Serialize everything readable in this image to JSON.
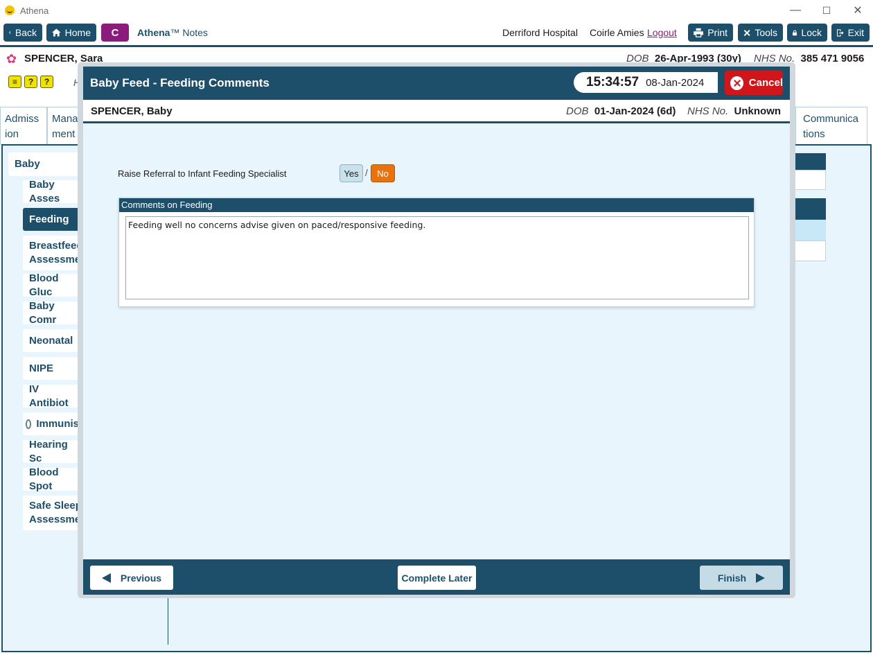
{
  "window": {
    "title": "Athena",
    "minimize": "—",
    "maximize": "☐",
    "close": "✕"
  },
  "toolbar": {
    "back_label": "Back",
    "home_label": "Home",
    "c_label": "C",
    "brand_name": "Athena",
    "brand_tm": "™",
    "brand_suffix": "Notes",
    "hospital": "Derriford Hospital",
    "user": "Coirle Amies",
    "logout_label": "Logout",
    "print_label": "Print",
    "tools_label": "Tools",
    "lock_label": "Lock",
    "exit_label": "Exit"
  },
  "patient": {
    "name": "SPENCER, Sara",
    "dob_label": "DOB",
    "dob": "26-Apr-1993 (30y)",
    "nhs_label": "NHS No.",
    "nhs": "385 471 9056"
  },
  "background": {
    "header_partial": "H",
    "tabs": [
      {
        "label": "Admiss ion"
      },
      {
        "label": "Mana ment"
      },
      {
        "label": "Communica tions"
      }
    ],
    "sidebar": {
      "group": "Baby",
      "items": [
        {
          "label": "Baby Asses"
        },
        {
          "label": "Feeding"
        },
        {
          "label": "Breastfeedi Assessmen"
        },
        {
          "label": "Blood Gluc"
        },
        {
          "label": "Baby Comr"
        },
        {
          "label": "Neonatal"
        },
        {
          "label": "NIPE"
        },
        {
          "label": "IV Antibiot"
        },
        {
          "label": "Immunis"
        },
        {
          "label": "Hearing Sc"
        },
        {
          "label": "Blood Spot"
        },
        {
          "label": "Safe Sleepi Assessmen"
        }
      ]
    }
  },
  "modal": {
    "title": "Baby Feed - Feeding Comments",
    "time": "15:34:57",
    "date": "08-Jan-2024",
    "cancel_label": "Cancel",
    "baby_name": "SPENCER, Baby",
    "baby_dob_label": "DOB",
    "baby_dob": "01-Jan-2024 (6d)",
    "baby_nhs_label": "NHS No.",
    "baby_nhs": "Unknown",
    "question": "Raise Referral to Infant Feeding Specialist",
    "yes_label": "Yes",
    "separator": "/",
    "no_label": "No",
    "selected_answer": "No",
    "comments_heading": "Comments on Feeding",
    "comments_text": "Feeding well no concerns advise given on paced/responsive feeding.",
    "previous_label": "Previous",
    "complete_later_label": "Complete Later",
    "finish_label": "Finish"
  },
  "colors": {
    "primary": "#1d4f6b",
    "accent_purple": "#8c1c7c",
    "cancel_red": "#d0151b",
    "no_orange": "#e8730e",
    "panel_bg": "#e9f5fc"
  }
}
